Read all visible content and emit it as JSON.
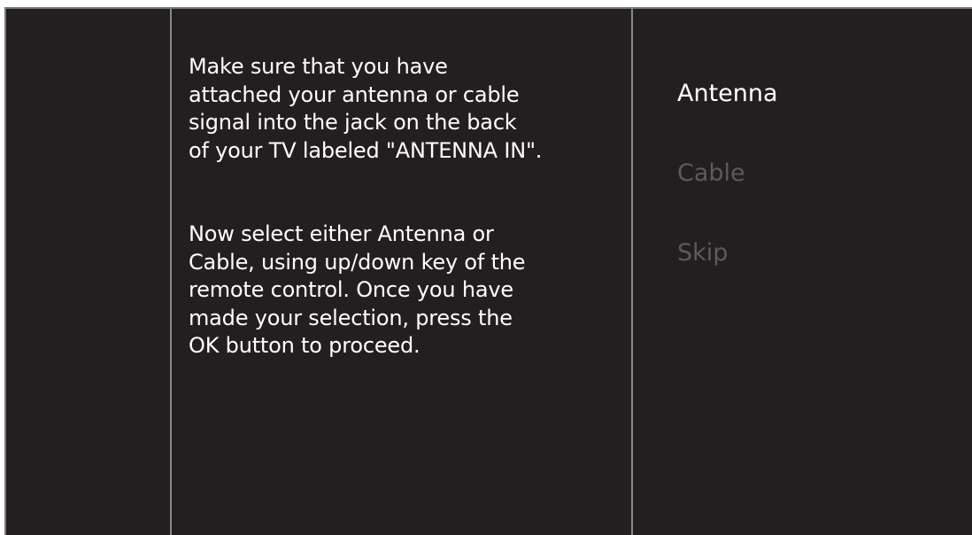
{
  "instructions": {
    "paragraph1": "Make sure that you have\nattached your antenna or cable\nsignal into the jack on the back\nof your TV labeled \"ANTENNA IN\".",
    "paragraph2": "Now select either Antenna or\nCable, using up/down key of the\nremote control. Once you have\nmade your selection, press the\nOK button to proceed."
  },
  "menu": {
    "items": [
      {
        "label": "Antenna",
        "selected": true
      },
      {
        "label": "Cable",
        "selected": false
      },
      {
        "label": "Skip",
        "selected": false
      }
    ]
  },
  "colors": {
    "background": "#231f20",
    "text": "#ffffff",
    "menu_inactive": "#5e5a5a",
    "divider": "#8a8888"
  }
}
